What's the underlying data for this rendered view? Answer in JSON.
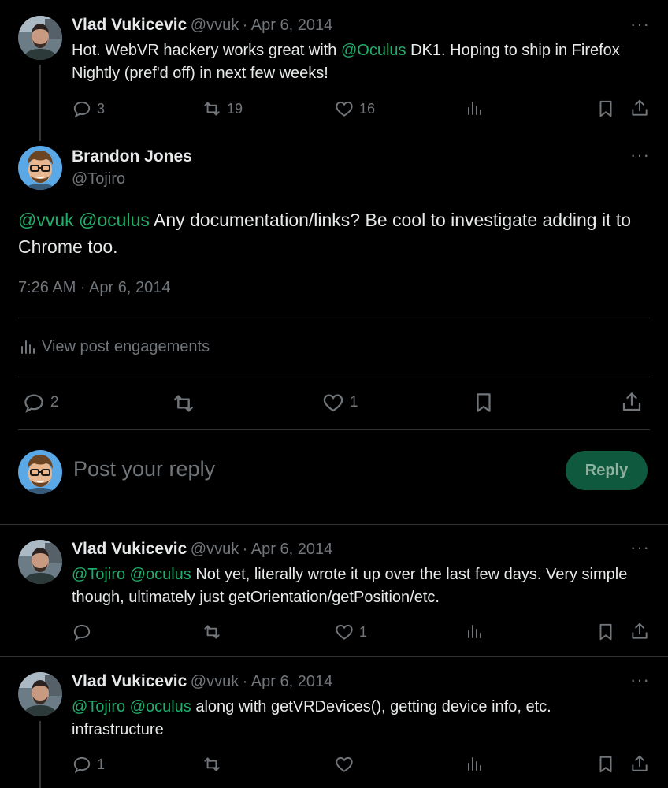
{
  "tweet1": {
    "name": "Vlad Vukicevic",
    "handle": "@vvuk",
    "date": "Apr 6, 2014",
    "text_before": "Hot. WebVR hackery works great with ",
    "mention": "@Oculus",
    "text_after": " DK1. Hoping to ship in Firefox Nightly (pref'd off) in next few weeks!",
    "replies": "3",
    "reposts": "19",
    "likes": "16"
  },
  "main_tweet": {
    "name": "Brandon Jones",
    "handle": "@Tojiro",
    "mention1": "@vvuk",
    "mention2": "@oculus",
    "text": " Any documentation/links? Be cool to investigate adding it to Chrome too.",
    "timestamp": "7:26 AM · Apr 6, 2014",
    "engagements_label": "View post engagements",
    "replies": "2",
    "likes": "1"
  },
  "composer": {
    "placeholder": "Post your reply",
    "reply_label": "Reply"
  },
  "reply1": {
    "name": "Vlad Vukicevic",
    "handle": "@vvuk",
    "date": "Apr 6, 2014",
    "mention1": "@Tojiro",
    "mention2": "@oculus",
    "text": " Not yet, literally wrote it up over the last few days.  Very simple though, ultimately just getOrientation/getPosition/etc.",
    "likes": "1"
  },
  "reply2": {
    "name": "Vlad Vukicevic",
    "handle": "@vvuk",
    "date": "Apr 6, 2014",
    "mention1": "@Tojiro",
    "mention2": "@oculus",
    "text": " along with getVRDevices(), getting device info, etc. infrastructure",
    "replies": "1"
  },
  "sep": "·",
  "more": "···",
  "colors": {
    "accent": "#1fae6a",
    "muted": "#71767b",
    "background": "#000000"
  },
  "icons": [
    "reply-icon",
    "repost-icon",
    "like-icon",
    "views-icon",
    "bookmark-icon",
    "share-icon",
    "more-icon"
  ]
}
